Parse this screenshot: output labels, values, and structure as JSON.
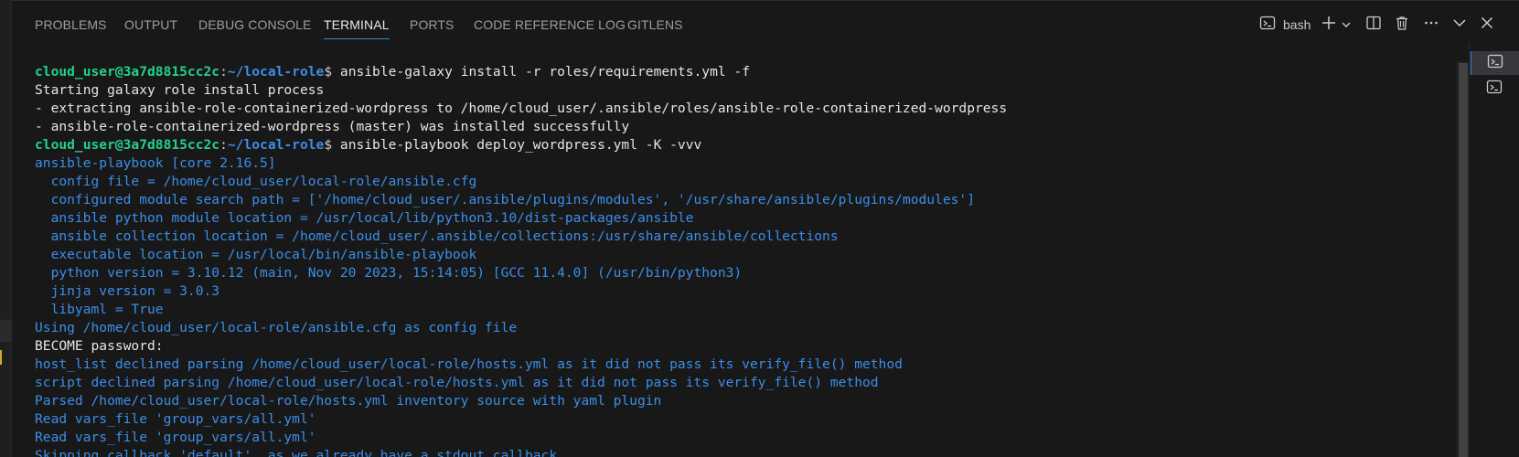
{
  "tabs": [
    {
      "label": "PROBLEMS",
      "active": false
    },
    {
      "label": "OUTPUT",
      "active": false
    },
    {
      "label": "DEBUG CONSOLE",
      "active": false
    },
    {
      "label": "TERMINAL",
      "active": true
    },
    {
      "label": "PORTS",
      "active": false
    },
    {
      "label": "CODE REFERENCE LOG",
      "active": false
    },
    {
      "label": "GITLENS",
      "active": false
    }
  ],
  "toolbar": {
    "shell_name": "bash",
    "icons": [
      "terminal-icon",
      "plus-icon",
      "chevron-down-icon",
      "split-icon",
      "trash-icon",
      "more-icon",
      "chevron-down-icon",
      "close-icon"
    ]
  },
  "colors": {
    "background": "#181818",
    "prompt_user": "#23d18b",
    "prompt_path": "#3b8eea",
    "blue_output": "#3b8eea",
    "active_tab_underline": "#2b8bd7"
  },
  "terminal": {
    "prompt_user": "cloud_user@3a7d8815cc2c",
    "prompt_path": "~/local-role",
    "lines": [
      {
        "type": "prompt",
        "cmd": " ansible-galaxy install -r roles/requirements.yml -f"
      },
      {
        "type": "white",
        "text": "Starting galaxy role install process"
      },
      {
        "type": "white",
        "text": "- extracting ansible-role-containerized-wordpress to /home/cloud_user/.ansible/roles/ansible-role-containerized-wordpress"
      },
      {
        "type": "white",
        "text": "- ansible-role-containerized-wordpress (master) was installed successfully"
      },
      {
        "type": "prompt",
        "cmd": " ansible-playbook deploy_wordpress.yml -K -vvv"
      },
      {
        "type": "blue",
        "text": "ansible-playbook [core 2.16.5]"
      },
      {
        "type": "blue",
        "text": "  config file = /home/cloud_user/local-role/ansible.cfg"
      },
      {
        "type": "blue",
        "text": "  configured module search path = ['/home/cloud_user/.ansible/plugins/modules', '/usr/share/ansible/plugins/modules']"
      },
      {
        "type": "blue",
        "text": "  ansible python module location = /usr/local/lib/python3.10/dist-packages/ansible"
      },
      {
        "type": "blue",
        "text": "  ansible collection location = /home/cloud_user/.ansible/collections:/usr/share/ansible/collections"
      },
      {
        "type": "blue",
        "text": "  executable location = /usr/local/bin/ansible-playbook"
      },
      {
        "type": "blue",
        "text": "  python version = 3.10.12 (main, Nov 20 2023, 15:14:05) [GCC 11.4.0] (/usr/bin/python3)"
      },
      {
        "type": "blue",
        "text": "  jinja version = 3.0.3"
      },
      {
        "type": "blue",
        "text": "  libyaml = True"
      },
      {
        "type": "blue",
        "text": "Using /home/cloud_user/local-role/ansible.cfg as config file"
      },
      {
        "type": "white",
        "text": "BECOME password:"
      },
      {
        "type": "blue",
        "text": "host_list declined parsing /home/cloud_user/local-role/hosts.yml as it did not pass its verify_file() method"
      },
      {
        "type": "blue",
        "text": "script declined parsing /home/cloud_user/local-role/hosts.yml as it did not pass its verify_file() method"
      },
      {
        "type": "blue",
        "text": "Parsed /home/cloud_user/local-role/hosts.yml inventory source with yaml plugin"
      },
      {
        "type": "blue",
        "text": "Read vars_file 'group_vars/all.yml'"
      },
      {
        "type": "blue",
        "text": "Read vars_file 'group_vars/all.yml'"
      },
      {
        "type": "blue",
        "text": "Skipping callback 'default', as we already have a stdout callback."
      }
    ]
  },
  "sessions": [
    {
      "icon": "terminal-icon",
      "active": true
    },
    {
      "icon": "terminal-icon",
      "active": false
    }
  ]
}
